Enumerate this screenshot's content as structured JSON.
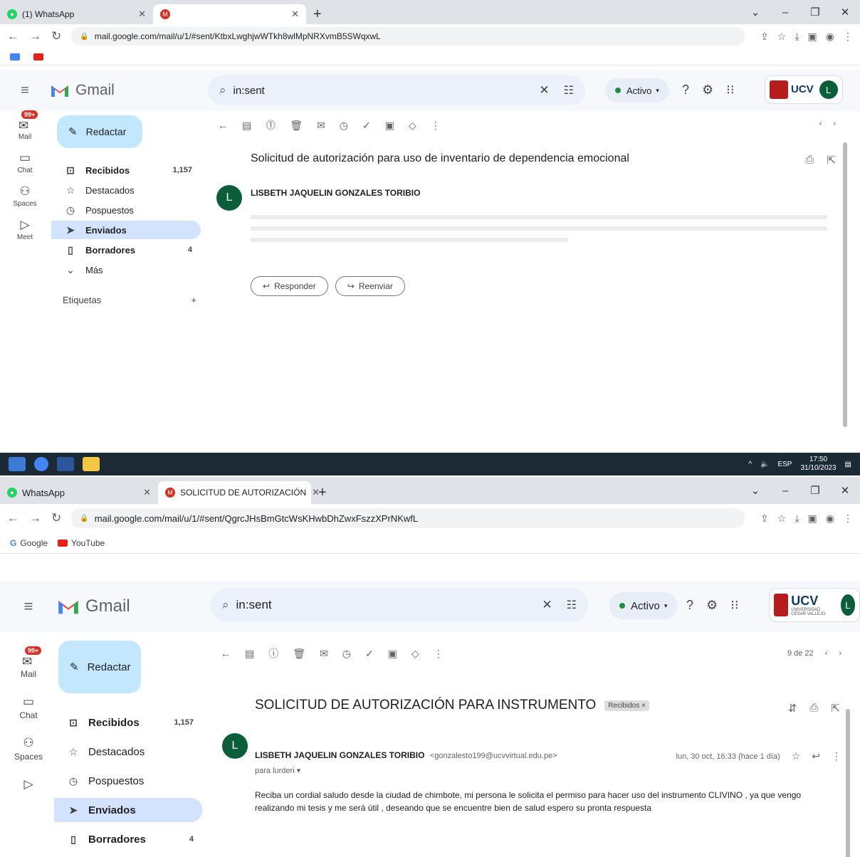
{
  "colors": {
    "gmail_bg": "#f6f8fc",
    "search_bg": "#eaf1fb",
    "selected_nav": "#d3e3fd",
    "compose_bg": "#c2e7ff",
    "avatar_green": "#0b5e3a",
    "active_green": "#1e8e3e",
    "badge_red": "#d93025",
    "ucv_red": "#b71c1c"
  },
  "shot1": {
    "tabs": [
      {
        "title": "(1) WhatsApp",
        "icon": "whatsapp-icon",
        "active": false
      },
      {
        "title": "",
        "icon": "gmail-icon",
        "active": true
      }
    ],
    "url": "mail.google.com/mail/u/1/#sent/KtbxLwghjwWTkh8wlMpNRXvmB5SWqxwL",
    "bookmarks": [],
    "app_name": "Gmail",
    "search_query": "in:sent",
    "status": "Activo",
    "ucv_label": "UCV",
    "avatar_letter": "L",
    "mail_badge": "99+",
    "rail": [
      "Mail",
      "Chat",
      "Spaces",
      "Meet"
    ],
    "compose": "Redactar",
    "nav": [
      {
        "label": "Recibidos",
        "count": "1,157",
        "icon": "inbox-icon"
      },
      {
        "label": "Destacados",
        "count": "",
        "icon": "star-icon"
      },
      {
        "label": "Pospuestos",
        "count": "",
        "icon": "clock-icon"
      },
      {
        "label": "Enviados",
        "count": "",
        "icon": "send-icon"
      },
      {
        "label": "Borradores",
        "count": "4",
        "icon": "draft-icon"
      },
      {
        "label": "Más",
        "count": "",
        "icon": "chevron-down-icon"
      }
    ],
    "labels_title": "Etiquetas",
    "subject": "Solicitud de autorización para uso de inventario de dependencia emocional",
    "sender": "LISBETH JAQUELIN GONZALES TORIBIO",
    "reply": "Responder",
    "forward": "Reenviar",
    "clock_time": "17:50",
    "clock_date": "31/10/2023",
    "tray_lang": "ESP"
  },
  "shot2": {
    "tabs": [
      {
        "title": "WhatsApp",
        "icon": "whatsapp-icon",
        "active": false
      },
      {
        "title": "SOLICITUD DE AUTORIZACIÓN",
        "icon": "gmail-icon",
        "active": true
      }
    ],
    "url": "mail.google.com/mail/u/1/#sent/QgrcJHsBmGtcWsKHwbDhZwxFszzXPrNKwfL",
    "bookmarks": [
      "Google",
      "YouTube"
    ],
    "app_name": "Gmail",
    "search_query": "in:sent",
    "status": "Activo",
    "ucv_label": "UCV",
    "ucv_sub": "UNIVERSIDAD CÉSAR VALLEJO",
    "avatar_letter": "L",
    "mail_badge": "99+",
    "rail": [
      "Mail",
      "Chat",
      "Spaces"
    ],
    "compose": "Redactar",
    "nav": [
      {
        "label": "Recibidos",
        "count": "1,157",
        "icon": "inbox-icon"
      },
      {
        "label": "Destacados",
        "count": "",
        "icon": "star-icon"
      },
      {
        "label": "Pospuestos",
        "count": "",
        "icon": "clock-icon"
      },
      {
        "label": "Enviados",
        "count": "",
        "icon": "send-icon"
      },
      {
        "label": "Borradores",
        "count": "4",
        "icon": "draft-icon"
      }
    ],
    "pager": "9 de 22",
    "subject": "SOLICITUD DE AUTORIZACIÓN PARA INSTRUMENTO",
    "chip": "Recibidos ×",
    "sender": "LISBETH JAQUELIN GONZALES TORIBIO",
    "sender_email": "<gonzalesto199@ucvvirtual.edu.pe>",
    "to": "para lurderi ▾",
    "date": "lun, 30 oct, 16:33 (hace 1 día)",
    "body": "Reciba un cordial saludo desde la ciudad de chimbote, mi persona le solicita el permiso para hacer uso del instrumento CLIVINO , ya que vengo realizando mi tesis y me será útil , deseando que se encuentre bien de salud espero su pronta respuesta"
  }
}
